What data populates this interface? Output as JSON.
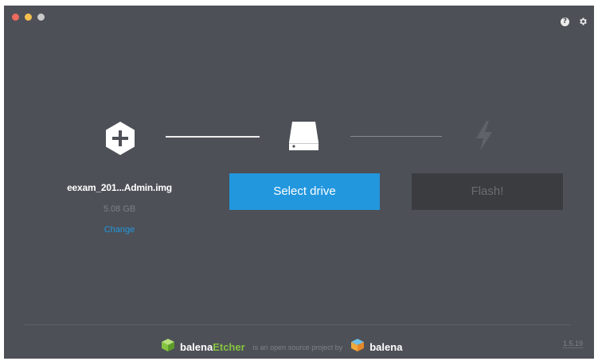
{
  "window": {
    "controls": [
      "close",
      "minimize",
      "zoom"
    ],
    "top_icons": [
      "help-icon",
      "gear-icon"
    ]
  },
  "steps": {
    "icons": [
      "plus-icon",
      "drive-icon",
      "flash-icon"
    ]
  },
  "image": {
    "name": "eexam_201...Admin.img",
    "size": "5.08 GB",
    "change_label": "Change"
  },
  "select_drive": {
    "label": "Select drive"
  },
  "flash": {
    "label": "Flash!"
  },
  "footer": {
    "brand_prefix": "balena",
    "brand_accent": "Etcher",
    "tagline": "is an open source project by",
    "company": "balena",
    "version": "1.5.19"
  },
  "colors": {
    "background": "#4d5057",
    "accent_blue": "#2297de",
    "etcher_green": "#85c440",
    "flash_disabled": "#3a3c40"
  }
}
